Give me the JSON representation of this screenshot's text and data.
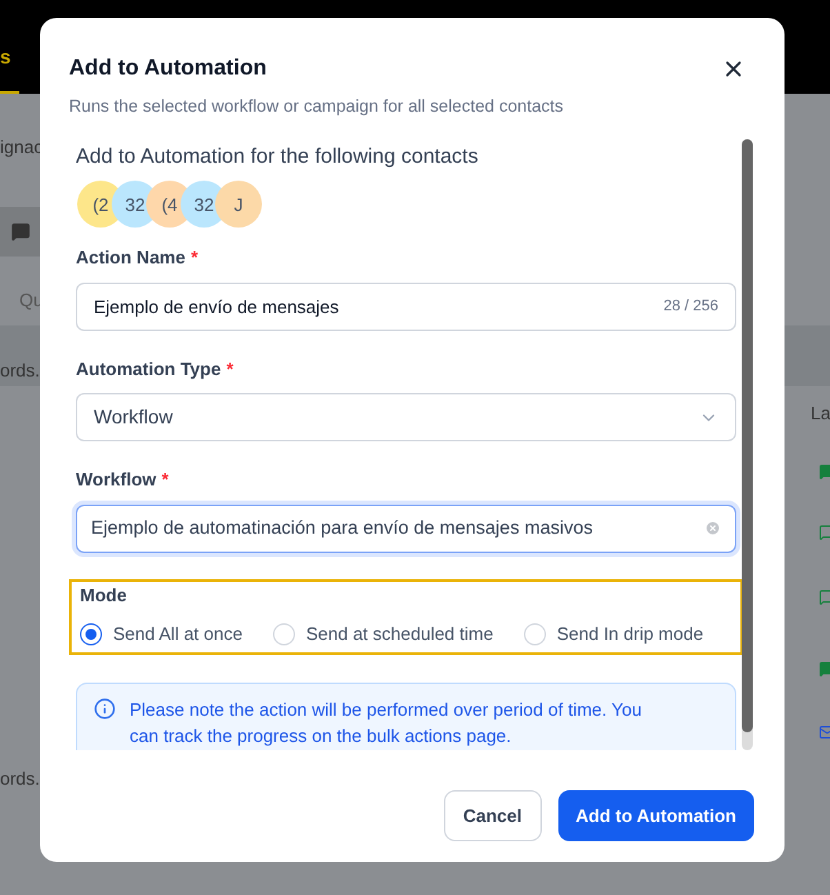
{
  "background": {
    "nav_tab": {
      "label": "s",
      "selected": true
    },
    "left_texts": [
      "ignac",
      "Qu",
      "ords.",
      "ords."
    ],
    "right_header": "La"
  },
  "dialog": {
    "title": "Add to Automation",
    "subtitle": "Runs the selected workflow or campaign for all selected contacts",
    "contacts_heading": "Add to Automation for the following contacts",
    "contacts": [
      {
        "initials": "(2",
        "color": "#fde68a"
      },
      {
        "initials": "32",
        "color": "#bae6fd"
      },
      {
        "initials": "(4",
        "color": "#fed7aa"
      },
      {
        "initials": "32",
        "color": "#bae6fd"
      },
      {
        "initials": "J",
        "color": "#fcd9a8"
      }
    ],
    "required_mark": "*",
    "action_name": {
      "label": "Action Name",
      "required": true,
      "value": "Ejemplo de envío de mensajes",
      "counter": "28 / 256"
    },
    "automation_type": {
      "label": "Automation Type",
      "required": true,
      "value": "Workflow"
    },
    "workflow": {
      "label": "Workflow",
      "required": true,
      "value": "Ejemplo de automatinación para envío de mensajes masivos",
      "focused": true
    },
    "mode": {
      "label": "Mode",
      "options": [
        {
          "label": "Send All at once",
          "selected": true
        },
        {
          "label": "Send at scheduled time",
          "selected": false
        },
        {
          "label": "Send In drip mode",
          "selected": false
        }
      ]
    },
    "note": "Please note the action will be performed over period of time. You can track the progress on the bulk actions page.",
    "buttons": [
      {
        "label": "Cancel",
        "kind": "secondary"
      },
      {
        "label": "Add to Automation",
        "kind": "primary"
      }
    ]
  }
}
